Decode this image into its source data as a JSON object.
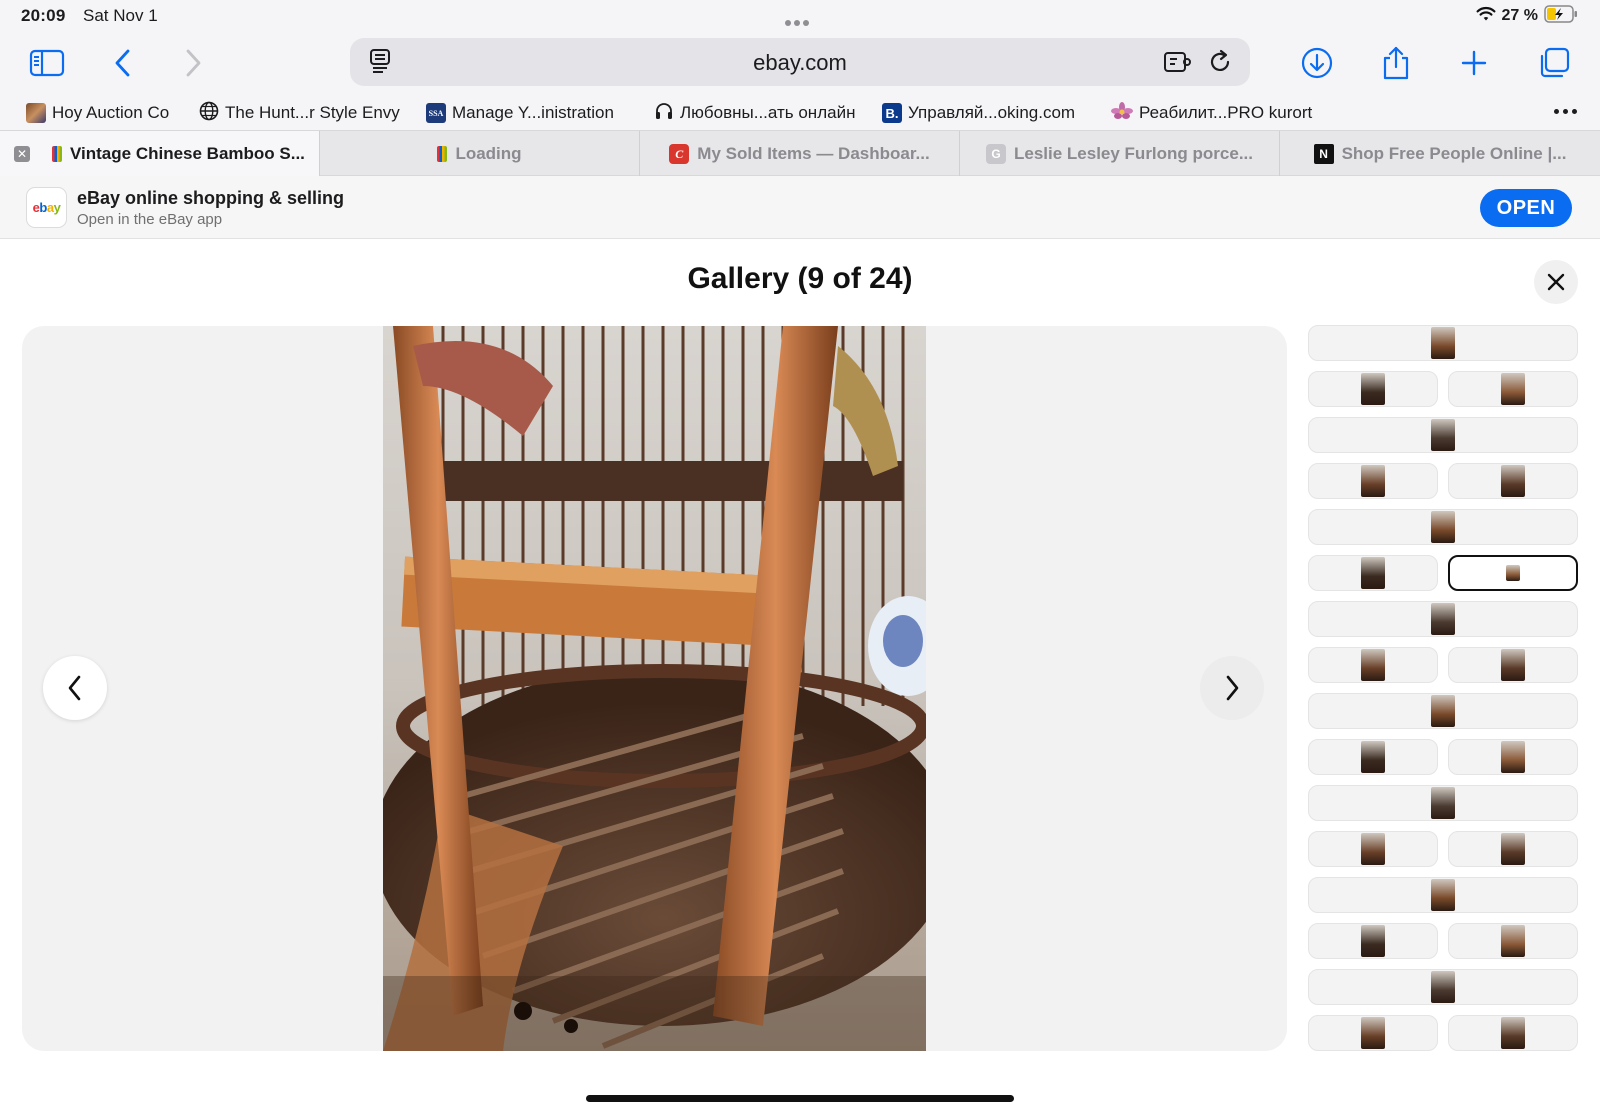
{
  "status_bar": {
    "time": "20:09",
    "date": "Sat Nov 1",
    "battery": "27 %"
  },
  "toolbar": {
    "url": "ebay.com",
    "icons": [
      "sidebar-icon",
      "back-icon",
      "forward-icon",
      "reader-icon",
      "extension-icon",
      "reload-icon",
      "download-icon",
      "share-icon",
      "plus-icon",
      "tabs-icon"
    ]
  },
  "bookmarks": [
    {
      "label": "Hoy Auction Co",
      "icon": "photo"
    },
    {
      "label": "The Hunt...r Style Envy",
      "icon": "globe"
    },
    {
      "label": "Manage Y...inistration",
      "icon": "SSA"
    },
    {
      "label": "Любовны...ать онлайн",
      "icon": "headphones"
    },
    {
      "label": "Управляй...oking.com",
      "icon": "B."
    },
    {
      "label": "Реабилит...PRO kurort",
      "icon": "flower"
    }
  ],
  "tabs": [
    {
      "label": "Vintage Chinese Bamboo S...",
      "active": true
    },
    {
      "label": "Loading",
      "active": false
    },
    {
      "label": "My Sold Items — Dashboar...",
      "active": false
    },
    {
      "label": "Leslie Lesley Furlong porce...",
      "active": false
    },
    {
      "label": "Shop Free People Online |...",
      "active": false
    }
  ],
  "app_banner": {
    "logo": "ebay",
    "title": "eBay online shopping & selling",
    "subtitle": "Open in the eBay app",
    "button": "OPEN"
  },
  "gallery": {
    "title": "Gallery (9 of 24)",
    "current_index": 9,
    "total": 24
  },
  "colors": {
    "open_button": "#0a6cf1",
    "chrome_bg": "#f5f5f7",
    "stage_bg": "#f2f2f2"
  }
}
